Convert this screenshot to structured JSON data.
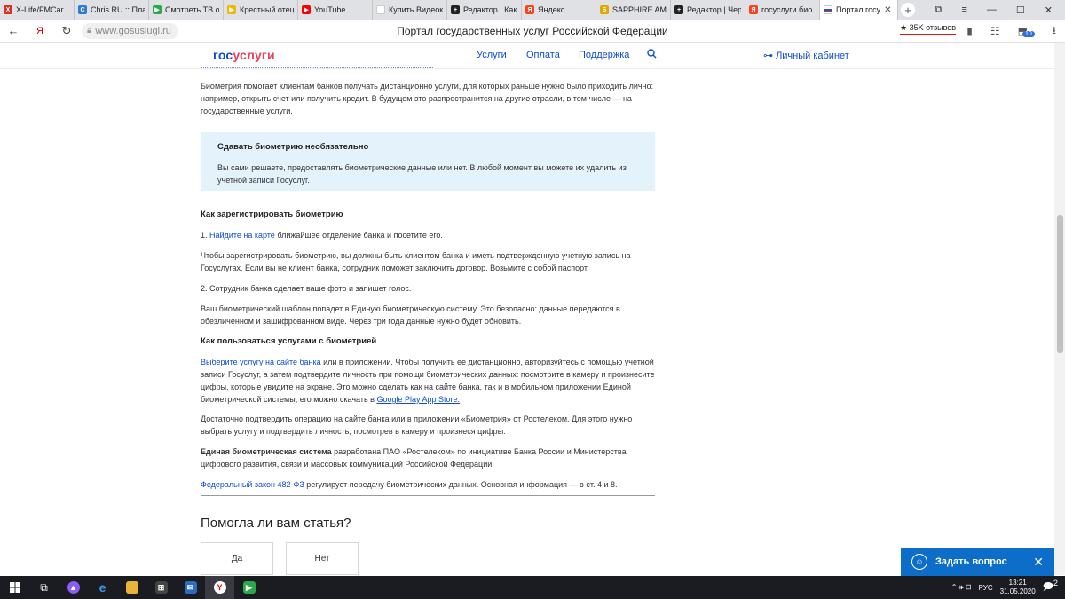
{
  "browser": {
    "tabs": [
      {
        "label": "X-Life/FMCar",
        "fav_color": "#d93025",
        "fav_glyph": "X"
      },
      {
        "label": "Chris.RU :: Пла",
        "fav_color": "#2e7bd6",
        "fav_glyph": "C"
      },
      {
        "label": "Смотреть ТВ о",
        "fav_color": "#2aa84a",
        "fav_glyph": "▶"
      },
      {
        "label": "Крестный отец",
        "fav_color": "#f2b705",
        "fav_glyph": "▶"
      },
      {
        "label": "YouTube",
        "fav_color": "#ff0000",
        "fav_glyph": "▶"
      },
      {
        "label": "Купить Видеок",
        "fav_color": "#ffffff",
        "fav_glyph": ""
      },
      {
        "label": "Редактор | Как",
        "fav_color": "#222222",
        "fav_glyph": "+"
      },
      {
        "label": "Яндекс",
        "fav_color": "#fc3f1d",
        "fav_glyph": "Я"
      },
      {
        "label": "SAPPHIRE AMD",
        "fav_color": "#e0a800",
        "fav_glyph": "S"
      },
      {
        "label": "Редактор | Чер",
        "fav_color": "#222222",
        "fav_glyph": "+"
      },
      {
        "label": "госуслуги био",
        "fav_color": "#fc3f1d",
        "fav_glyph": "Я"
      }
    ],
    "active_tab": {
      "label": "Портал госу",
      "close": "✕"
    },
    "new_tab": "+",
    "window_controls": [
      "⧉",
      "≡",
      "—",
      "☐",
      "✕"
    ],
    "url": "www.gosuslugi.ru",
    "title": "Портал государственных услуг Российской Федерации",
    "reviews": "★ 35K отзывов",
    "ext_badge": "10"
  },
  "header": {
    "logo_gos": "гос",
    "logo_uslugi": "услуги",
    "nav": [
      "Услуги",
      "Оплата",
      "Поддержка"
    ],
    "cabinet": "Личный кабинет",
    "cabinet_icon": "⊶"
  },
  "article": {
    "intro": "Биометрия помогает клиентам банков получать дистанционно услуги, для которых раньше нужно было приходить лично: например, открыть счет или получить кредит. В будущем это распространится на другие отрасли, в том числе — на государственные услуги.",
    "callout_title": "Сдавать биометрию необязательно",
    "callout_body": "Вы сами решаете, предоставлять биометрические данные или нет. В любой момент вы можете их удалить из учетной записи Госуслуг.",
    "h_register": "Как зарегистрировать биометрию",
    "step1_num": "1. ",
    "step1_link": "Найдите на карте",
    "step1_rest": " ближайшее отделение банка и посетите его.",
    "p_client": "Чтобы зарегистрировать биометрию, вы должны быть клиентом банка и иметь подтвержденную учетную запись на Госуслугах. Если вы не клиент банка, сотрудник поможет заключить договор. Возьмите с собой паспорт.",
    "step2": "2. Сотрудник банка сделает ваше фото и запишет голос.",
    "p_template": "Ваш биометрический шаблон попадет в Единую биометрическую систему. Это безопасно: данные передаются в обезличенном и зашифрованном виде. Через три года данные нужно будет обновить.",
    "h_use": "Как пользоваться услугами с биометрией",
    "use_link": "Выберите услугу на сайте банка",
    "use_rest": " или в приложении. Чтобы получить ее дистанционно, авторизуйтесь с помощью учетной записи Госуслуг, а затем подтвердите личность при помощи биометрических данных: посмотрите в камеру и произнесите цифры, которые увидите на экране. Это можно сделать как на сайте банка, так и в мобильном приложении Единой биометрической системы, его можно скачать в ",
    "google_play": "Google Play",
    "app_store": " App Store.",
    "p_confirm": "Достаточно подтвердить операцию на сайте банка или в приложении «Биометрия» от Ростелеком. Для этого нужно выбрать услугу и подтвердить личность, посмотрев в камеру и произнеся цифры.",
    "ebs_bold": "Единая биометрическая система",
    "ebs_rest": " разработана ПАО «Ростелеком» по инициативе Банка России и Министерства цифрового развития, связи и массовых коммуникаций Российской Федерации.",
    "law_link": "Федеральный закон 482-ФЗ",
    "law_rest": " регулирует передачу биометрических данных. Основная информация — в ст. 4 и 8."
  },
  "feedback": {
    "question": "Помогла ли вам статья?",
    "yes": "Да",
    "no": "Нет"
  },
  "chat": {
    "label": "Задать вопрос",
    "close": "✕"
  },
  "taskbar": {
    "lang": "РУС",
    "time": "13:21",
    "date": "31.05.2020",
    "tray_glyphs": "⌃ 🕪 ⊡",
    "notify_count": "2"
  },
  "colors": {
    "brand_blue": "#0d4cd3",
    "brand_red": "#ee3f58",
    "callout_bg": "#e4f2fb",
    "chat_bg": "#0d6ec9"
  }
}
